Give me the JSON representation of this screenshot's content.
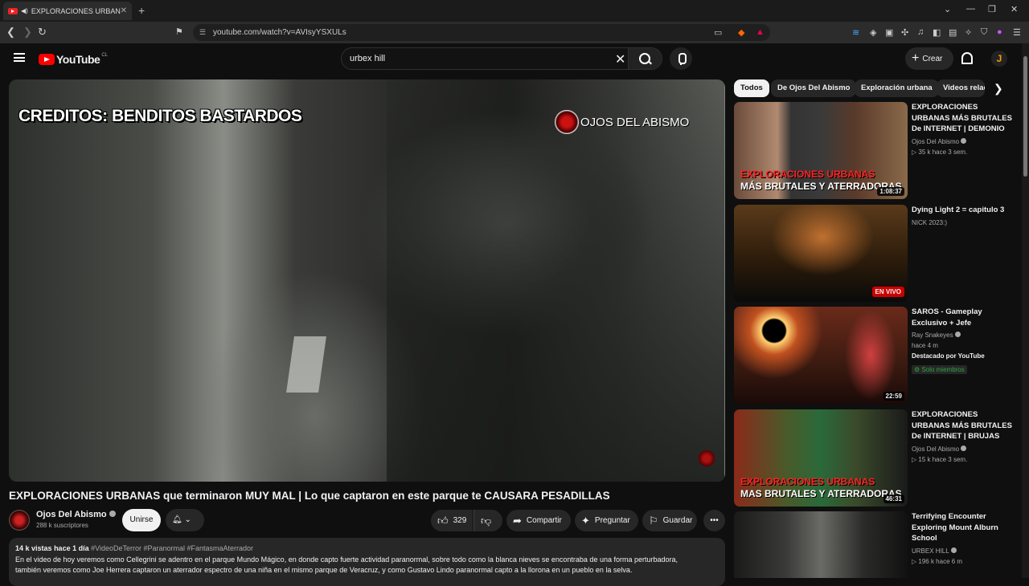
{
  "browser": {
    "tab_title": "EXPLORACIONES URBANAS q",
    "url": "youtube.com/watch?v=AVIsyYSXULs"
  },
  "header": {
    "logo": "YouTube",
    "country": "CL",
    "search_query": "urbex hill",
    "create_label": "Crear",
    "avatar_letter": "J"
  },
  "player": {
    "credits_text": "CREDITOS: BENDITOS BASTARDOS",
    "brand_text": "OJOS DEL ABISMO"
  },
  "video": {
    "title": "EXPLORACIONES URBANAS que terminaron MUY MAL | Lo que captaron en este parque te CAUSARA PESADILLAS",
    "channel": "Ojos Del Abismo",
    "subscribers": "288 k suscriptores",
    "join_label": "Unirse",
    "likes": "329",
    "share_label": "Compartir",
    "ask_label": "Preguntar",
    "save_label": "Guardar",
    "views": "14 k vistas",
    "age": "hace 1 día",
    "tags": "#VideoDeTerror #Paranormal #FantasmaAterrador",
    "description_line1": "En el video de hoy veremos como Cellegrini se adentro en el parque Mundo Mágico, en donde capto fuerte actividad paranormal, sobre todo como la blanca nieves se encontraba de una forma perturbadora,",
    "description_line2": "también veremos como Joe Herrera captaron un aterrador espectro de una niña en el mismo parque de Veracruz, y como Gustavo Lindo paranormal capto a la llorona en un pueblo en la selva."
  },
  "chips": [
    "Todos",
    "De Ojos Del Abismo",
    "Exploración urbana",
    "Videos relac"
  ],
  "recommendations": [
    {
      "title": "EXPLORACIONES URBANAS MÁS BRUTALES De INTERNET | DEMONIO ATAC...",
      "channel": "Ojos Del Abismo",
      "meta": "▷ 35 k  hace 3 sem.",
      "duration": "1:08:37",
      "overlay1": "EXPLORACIONES URBANAS",
      "overlay2": "MÁS BRUTALES Y ATERRADORAS"
    },
    {
      "title": "Dying Light 2 = capitulo 3",
      "channel": "NICK 2023:)",
      "live": "EN VIVO"
    },
    {
      "title": "SAROS - Gameplay Exclusivo + Jefe",
      "channel": "Ray Snakeyes",
      "meta": "hace 4 m",
      "featured": "Destacado por YouTube",
      "members": "Solo miembros",
      "duration": "22:59"
    },
    {
      "title": "EXPLORACIONES URBANAS MÁS BRUTALES De INTERNET | BRUJAS REALE...",
      "channel": "Ojos Del Abismo",
      "meta": "▷ 15 k  hace 3 sem.",
      "duration": "46:31",
      "overlay1": "EXPLORACIONES URBANAS",
      "overlay2": "MAS BRUTALES Y ATERRADORAS"
    },
    {
      "title": "Terrifying Encounter Exploring Mount Alburn School",
      "channel": "URBEX HILL",
      "meta": "▷ 196 k  hace 6 m"
    }
  ]
}
